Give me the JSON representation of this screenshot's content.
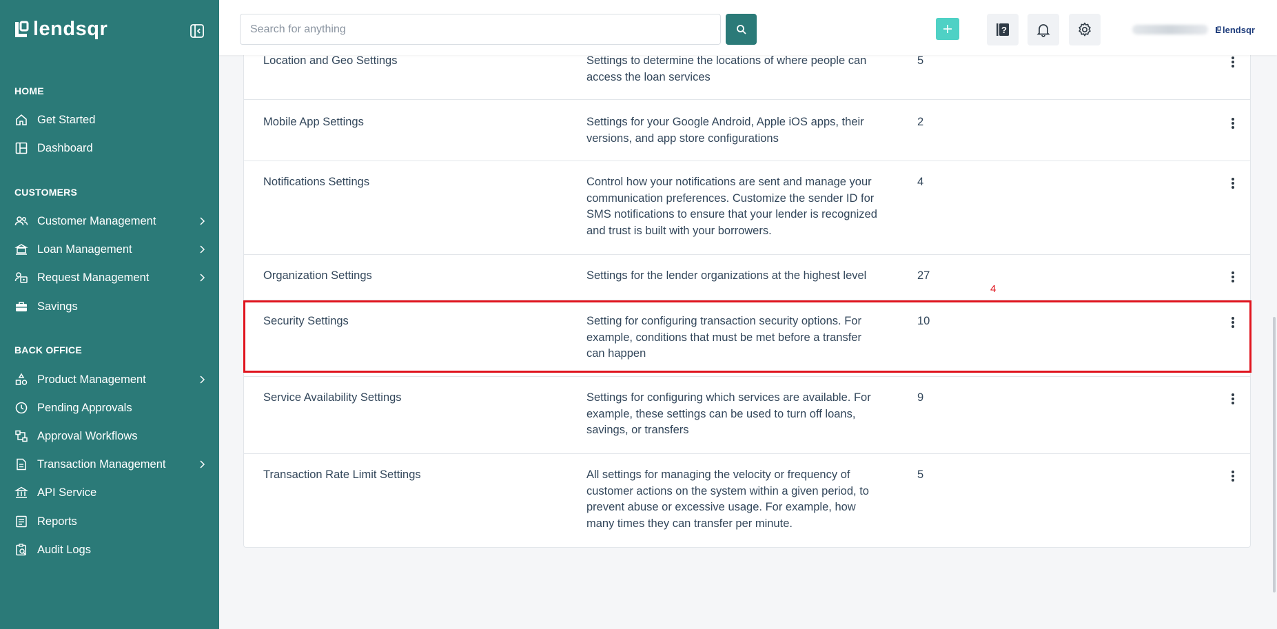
{
  "brand": {
    "logo_text": "lendsqr",
    "mini_logo_text": "lendsqr"
  },
  "sidebar": {
    "sections": [
      {
        "title": "HOME"
      },
      {
        "title": "CUSTOMERS"
      },
      {
        "title": "BACK OFFICE"
      }
    ],
    "items": [
      {
        "label": "Get Started",
        "icon": "home-icon"
      },
      {
        "label": "Dashboard",
        "icon": "dashboard-icon"
      },
      {
        "label": "Customer Management",
        "icon": "users-icon",
        "has_chevron": true
      },
      {
        "label": "Loan Management",
        "icon": "loan-icon",
        "has_chevron": true
      },
      {
        "label": "Request Management",
        "icon": "request-icon",
        "has_chevron": true
      },
      {
        "label": "Savings",
        "icon": "briefcase-icon"
      },
      {
        "label": "Product Management",
        "icon": "product-icon",
        "has_chevron": true
      },
      {
        "label": "Pending Approvals",
        "icon": "clock-icon"
      },
      {
        "label": "Approval Workflows",
        "icon": "workflow-icon"
      },
      {
        "label": "Transaction Management",
        "icon": "transaction-icon",
        "has_chevron": true
      },
      {
        "label": "API Service",
        "icon": "bank-icon"
      },
      {
        "label": "Reports",
        "icon": "reports-icon"
      },
      {
        "label": "Audit Logs",
        "icon": "audit-icon"
      }
    ]
  },
  "header": {
    "search": {
      "placeholder": "Search for anything",
      "value": ""
    }
  },
  "settings_table": {
    "rows": [
      {
        "name": "Location and Geo Settings",
        "description": "Settings to determine the locations of where people can access the loan services",
        "count": "5"
      },
      {
        "name": "Mobile App Settings",
        "description": "Settings for your Google Android, Apple iOS apps, their versions, and app store configurations",
        "count": "2"
      },
      {
        "name": "Notifications Settings",
        "description": "Control how your notifications are sent and manage your communication preferences. Customize the sender ID for SMS notifications to ensure that your lender is recognized and trust is built with your borrowers.",
        "count": "4"
      },
      {
        "name": "Organization Settings",
        "description": "Settings for the lender organizations at the highest level",
        "count": "27"
      },
      {
        "name": "Security Settings",
        "description": "Setting for configuring transaction security options. For example, conditions that must be met before a transfer can happen",
        "count": "10"
      },
      {
        "name": "Service Availability Settings",
        "description": "Settings for configuring which services are available. For example, these settings can be used to turn off loans, savings, or transfers",
        "count": "9"
      },
      {
        "name": "Transaction Rate Limit Settings",
        "description": "All settings for managing the velocity or frequency of customer actions on the system within a given period, to prevent abuse or excessive usage. For example, how many times they can transfer per minute.",
        "count": "5"
      }
    ]
  },
  "annotation": {
    "label": "4",
    "color": "#e0141e"
  },
  "colors": {
    "sidebar_bg": "#2b7a78",
    "accent": "#4fd1c5",
    "text": "#33475b"
  }
}
